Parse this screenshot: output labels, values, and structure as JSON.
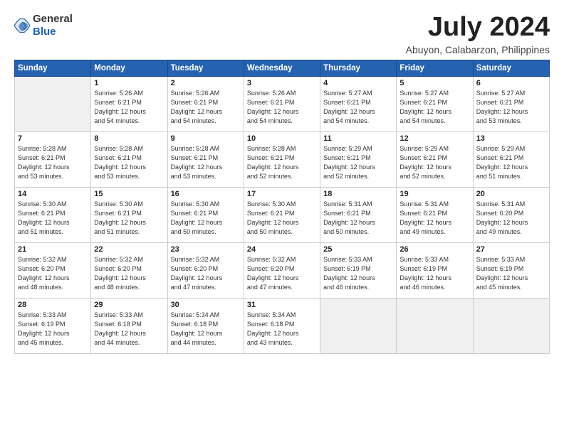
{
  "logo": {
    "text_general": "General",
    "text_blue": "Blue"
  },
  "header": {
    "title": "July 2024",
    "subtitle": "Abuyon, Calabarzon, Philippines"
  },
  "weekdays": [
    "Sunday",
    "Monday",
    "Tuesday",
    "Wednesday",
    "Thursday",
    "Friday",
    "Saturday"
  ],
  "weeks": [
    [
      {
        "day": "",
        "info": ""
      },
      {
        "day": "1",
        "info": "Sunrise: 5:26 AM\nSunset: 6:21 PM\nDaylight: 12 hours\nand 54 minutes."
      },
      {
        "day": "2",
        "info": "Sunrise: 5:26 AM\nSunset: 6:21 PM\nDaylight: 12 hours\nand 54 minutes."
      },
      {
        "day": "3",
        "info": "Sunrise: 5:26 AM\nSunset: 6:21 PM\nDaylight: 12 hours\nand 54 minutes."
      },
      {
        "day": "4",
        "info": "Sunrise: 5:27 AM\nSunset: 6:21 PM\nDaylight: 12 hours\nand 54 minutes."
      },
      {
        "day": "5",
        "info": "Sunrise: 5:27 AM\nSunset: 6:21 PM\nDaylight: 12 hours\nand 54 minutes."
      },
      {
        "day": "6",
        "info": "Sunrise: 5:27 AM\nSunset: 6:21 PM\nDaylight: 12 hours\nand 53 minutes."
      }
    ],
    [
      {
        "day": "7",
        "info": "Sunrise: 5:28 AM\nSunset: 6:21 PM\nDaylight: 12 hours\nand 53 minutes."
      },
      {
        "day": "8",
        "info": "Sunrise: 5:28 AM\nSunset: 6:21 PM\nDaylight: 12 hours\nand 53 minutes."
      },
      {
        "day": "9",
        "info": "Sunrise: 5:28 AM\nSunset: 6:21 PM\nDaylight: 12 hours\nand 53 minutes."
      },
      {
        "day": "10",
        "info": "Sunrise: 5:28 AM\nSunset: 6:21 PM\nDaylight: 12 hours\nand 52 minutes."
      },
      {
        "day": "11",
        "info": "Sunrise: 5:29 AM\nSunset: 6:21 PM\nDaylight: 12 hours\nand 52 minutes."
      },
      {
        "day": "12",
        "info": "Sunrise: 5:29 AM\nSunset: 6:21 PM\nDaylight: 12 hours\nand 52 minutes."
      },
      {
        "day": "13",
        "info": "Sunrise: 5:29 AM\nSunset: 6:21 PM\nDaylight: 12 hours\nand 51 minutes."
      }
    ],
    [
      {
        "day": "14",
        "info": "Sunrise: 5:30 AM\nSunset: 6:21 PM\nDaylight: 12 hours\nand 51 minutes."
      },
      {
        "day": "15",
        "info": "Sunrise: 5:30 AM\nSunset: 6:21 PM\nDaylight: 12 hours\nand 51 minutes."
      },
      {
        "day": "16",
        "info": "Sunrise: 5:30 AM\nSunset: 6:21 PM\nDaylight: 12 hours\nand 50 minutes."
      },
      {
        "day": "17",
        "info": "Sunrise: 5:30 AM\nSunset: 6:21 PM\nDaylight: 12 hours\nand 50 minutes."
      },
      {
        "day": "18",
        "info": "Sunrise: 5:31 AM\nSunset: 6:21 PM\nDaylight: 12 hours\nand 50 minutes."
      },
      {
        "day": "19",
        "info": "Sunrise: 5:31 AM\nSunset: 6:21 PM\nDaylight: 12 hours\nand 49 minutes."
      },
      {
        "day": "20",
        "info": "Sunrise: 5:31 AM\nSunset: 6:20 PM\nDaylight: 12 hours\nand 49 minutes."
      }
    ],
    [
      {
        "day": "21",
        "info": "Sunrise: 5:32 AM\nSunset: 6:20 PM\nDaylight: 12 hours\nand 48 minutes."
      },
      {
        "day": "22",
        "info": "Sunrise: 5:32 AM\nSunset: 6:20 PM\nDaylight: 12 hours\nand 48 minutes."
      },
      {
        "day": "23",
        "info": "Sunrise: 5:32 AM\nSunset: 6:20 PM\nDaylight: 12 hours\nand 47 minutes."
      },
      {
        "day": "24",
        "info": "Sunrise: 5:32 AM\nSunset: 6:20 PM\nDaylight: 12 hours\nand 47 minutes."
      },
      {
        "day": "25",
        "info": "Sunrise: 5:33 AM\nSunset: 6:19 PM\nDaylight: 12 hours\nand 46 minutes."
      },
      {
        "day": "26",
        "info": "Sunrise: 5:33 AM\nSunset: 6:19 PM\nDaylight: 12 hours\nand 46 minutes."
      },
      {
        "day": "27",
        "info": "Sunrise: 5:33 AM\nSunset: 6:19 PM\nDaylight: 12 hours\nand 45 minutes."
      }
    ],
    [
      {
        "day": "28",
        "info": "Sunrise: 5:33 AM\nSunset: 6:19 PM\nDaylight: 12 hours\nand 45 minutes."
      },
      {
        "day": "29",
        "info": "Sunrise: 5:33 AM\nSunset: 6:18 PM\nDaylight: 12 hours\nand 44 minutes."
      },
      {
        "day": "30",
        "info": "Sunrise: 5:34 AM\nSunset: 6:18 PM\nDaylight: 12 hours\nand 44 minutes."
      },
      {
        "day": "31",
        "info": "Sunrise: 5:34 AM\nSunset: 6:18 PM\nDaylight: 12 hours\nand 43 minutes."
      },
      {
        "day": "",
        "info": ""
      },
      {
        "day": "",
        "info": ""
      },
      {
        "day": "",
        "info": ""
      }
    ]
  ]
}
